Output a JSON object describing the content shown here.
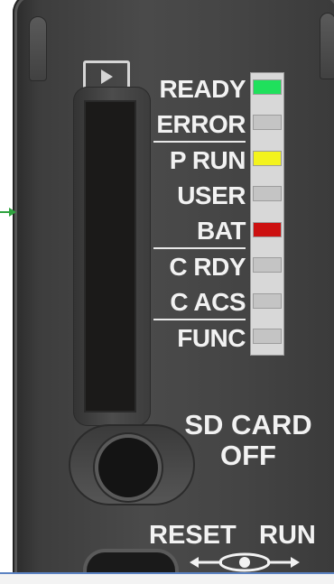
{
  "status_leds": [
    {
      "label": "READY",
      "state": "on",
      "color": "#1fe05c"
    },
    {
      "label": "ERROR",
      "state": "off",
      "color": "#c4c4c4"
    },
    {
      "label": "P RUN",
      "state": "on",
      "color": "#f3f31d"
    },
    {
      "label": "USER",
      "state": "off",
      "color": "#c4c4c4"
    },
    {
      "label": "BAT",
      "state": "on",
      "color": "#cc1010"
    },
    {
      "label": "C RDY",
      "state": "off",
      "color": "#c4c4c4"
    },
    {
      "label": "C ACS",
      "state": "off",
      "color": "#c4c4c4"
    },
    {
      "label": "FUNC",
      "state": "off",
      "color": "#c4c4c4"
    }
  ],
  "sd_card": {
    "line1": "SD CARD",
    "line2": "OFF"
  },
  "switch": {
    "left_label": "RESET",
    "right_label": "RUN"
  },
  "icons": {
    "display": "play-icon",
    "arrow": "arrow-right-icon"
  },
  "colors": {
    "panel": "#454545",
    "text": "#f2f2f2",
    "arrow": "#2fa33f"
  }
}
